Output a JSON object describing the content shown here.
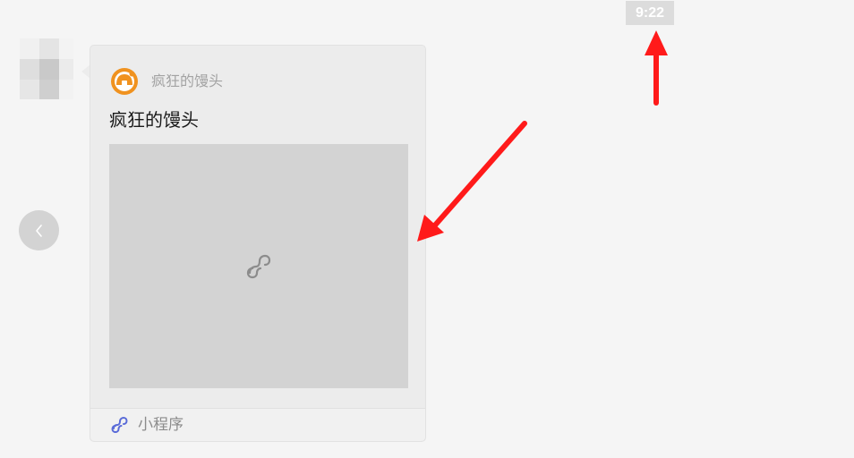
{
  "timestamp": "9:22",
  "message_card": {
    "app_name": "疯狂的馒头",
    "title": "疯狂的馒头",
    "footer_label": "小程序"
  },
  "colors": {
    "background": "#f5f5f5",
    "card": "#ececec",
    "image_placeholder": "#d3d3d3",
    "annotation": "#ff1a1a",
    "mini_program_icon": "#5a6bd8",
    "logo_orange": "#f0921f"
  },
  "icons": {
    "back": "chevron-left-icon",
    "placeholder": "mini-program-icon",
    "logo": "app-logo-icon",
    "footer": "mini-program-icon"
  }
}
